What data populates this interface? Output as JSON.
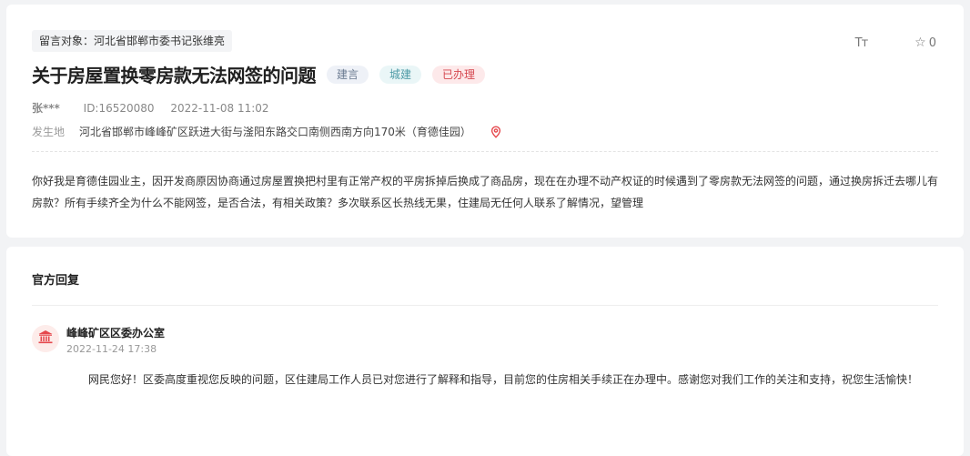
{
  "message": {
    "target_label": "留言对象：河北省邯郸市委书记张维亮",
    "title": "关于房屋置换零房款无法网签的问题",
    "tags": [
      "建言",
      "城建",
      "已办理"
    ],
    "font_tool_label": "Tт",
    "favorite_count": "0",
    "author": "张***",
    "id_text": "ID:16520080",
    "datetime": "2022-11-08 11:02",
    "place_label": "发生地",
    "place_value": "河北省邯郸市峰峰矿区跃进大街与滏阳东路交口南侧西南方向170米（育德佳园）",
    "content": "你好我是育德佳园业主，因开发商原因协商通过房屋置换把村里有正常产权的平房拆掉后换成了商品房，现在在办理不动产权证的时候遇到了零房款无法网签的问题，通过换房拆迁去哪儿有房款？所有手续齐全为什么不能网签，是否合法，有相关政策？多次联系区长热线无果，住建局无任何人联系了解情况，望管理"
  },
  "reply": {
    "section_title": "官方回复",
    "office_name": "峰峰矿区区委办公室",
    "date": "2022-11-24 17:38",
    "content": "网民您好！区委高度重视您反映的问题，区住建局工作人员已对您进行了解释和指导，目前您的住房相关手续正在办理中。感谢您对我们工作的关注和支持，祝您生活愉快！"
  },
  "colors": {
    "pin": "#e5484d",
    "avatar_bg": "#fdecea",
    "avatar_icon": "#e5484d"
  },
  "icons": {
    "favorite": "star-outline-icon",
    "place": "location-pin-icon",
    "office": "government-building-icon"
  }
}
